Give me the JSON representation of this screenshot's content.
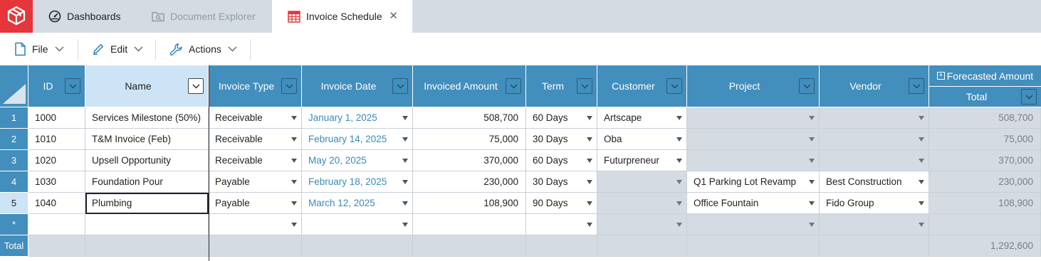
{
  "tabs": [
    {
      "label": "Dashboards",
      "icon": "gauge-icon",
      "active": false
    },
    {
      "label": "Document Explorer",
      "icon": "folder-search-icon",
      "active": false
    },
    {
      "label": "Invoice Schedule",
      "icon": "spreadsheet-icon",
      "active": true
    }
  ],
  "toolbar": {
    "file_label": "File",
    "edit_label": "Edit",
    "actions_label": "Actions"
  },
  "columns": {
    "id": "ID",
    "name": "Name",
    "invoice_type": "Invoice Type",
    "invoice_date": "Invoice Date",
    "invoiced_amount": "Invoiced Amount",
    "term": "Term",
    "customer": "Customer",
    "project": "Project",
    "vendor": "Vendor",
    "forecasted_group": "Forecasted Amount",
    "forecasted_total": "Total"
  },
  "rows": [
    {
      "num": "1",
      "id": "1000",
      "name": "Services Milestone (50%)",
      "type": "Receivable",
      "date": "January 1, 2025",
      "amount": "508,700",
      "term": "60 Days",
      "customer": "Artscape",
      "project": "",
      "vendor": "",
      "forecast": "508,700"
    },
    {
      "num": "2",
      "id": "1010",
      "name": "T&M Invoice (Feb)",
      "type": "Receivable",
      "date": "February 14, 2025",
      "amount": "75,000",
      "term": "30 Days",
      "customer": "Oba",
      "project": "",
      "vendor": "",
      "forecast": "75,000"
    },
    {
      "num": "3",
      "id": "1020",
      "name": "Upsell Opportunity",
      "type": "Receivable",
      "date": "May 20, 2025",
      "amount": "370,000",
      "term": "60 Days",
      "customer": "Futurpreneur",
      "project": "",
      "vendor": "",
      "forecast": "370,000"
    },
    {
      "num": "4",
      "id": "1030",
      "name": "Foundation Pour",
      "type": "Payable",
      "date": "February 18, 2025",
      "amount": "230,000",
      "term": "30 Days",
      "customer": "",
      "project": "Q1 Parking Lot Revamp",
      "vendor": "Best Construction",
      "forecast": "230,000"
    },
    {
      "num": "5",
      "id": "1040",
      "name": "Plumbing",
      "type": "Payable",
      "date": "March 12, 2025",
      "amount": "108,900",
      "term": "90 Days",
      "customer": "",
      "project": "Office Fountain",
      "vendor": "Fido Group",
      "forecast": "108,900"
    }
  ],
  "new_row_marker": "*",
  "total_row": {
    "label": "Total",
    "forecast_total": "1,292,600"
  },
  "colors": {
    "header_blue": "#428ebd",
    "logo_red": "#e5363b",
    "date_blue": "#3a8ab8",
    "gray_cell": "#d4dbe3"
  }
}
